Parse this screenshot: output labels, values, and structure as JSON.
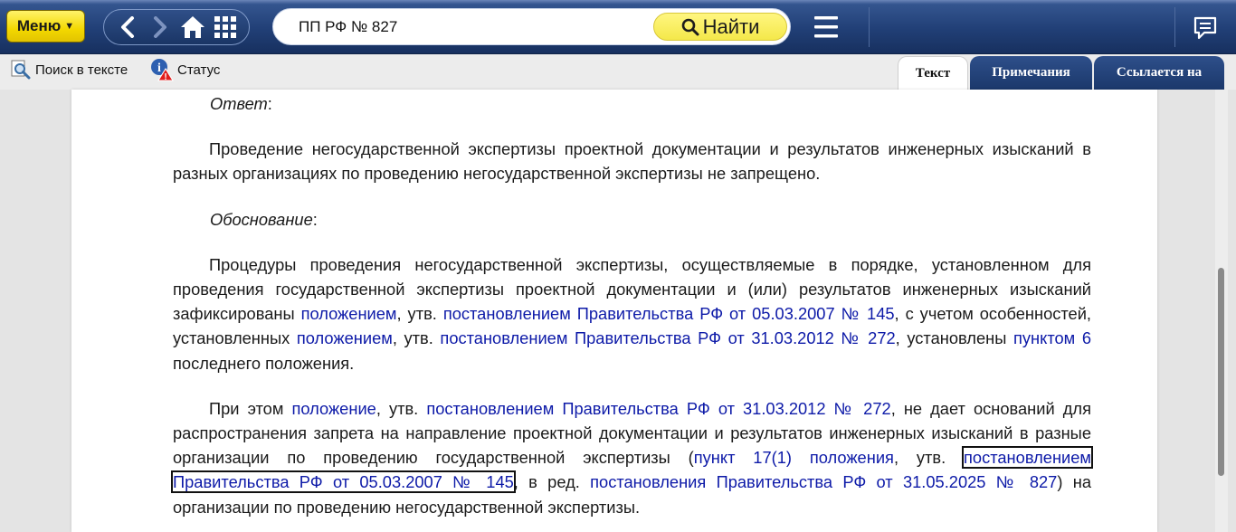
{
  "topbar": {
    "menu_label": "Меню",
    "search_value": "ПП РФ № 827",
    "find_label": "Найти"
  },
  "toolbar": {
    "search_in_text": "Поиск в тексте",
    "status": "Статус"
  },
  "tabs": [
    {
      "label": "Текст",
      "active": true
    },
    {
      "label": "Примечания",
      "active": false
    },
    {
      "label": "Ссылается на",
      "active": false
    }
  ],
  "doc": {
    "answer_label": "Ответ",
    "colon": ":",
    "p1": "Проведение негосударственной экспертизы проектной документации и результатов инженерных изысканий в разных организациях по проведению негосударственной экспертизы не запрещено.",
    "basis_label": "Обоснование",
    "p2": {
      "t1": "Процедуры проведения негосударственной экспертизы, осуществляемые в порядке, установленном для проведения государственной экспертизы проектной документации и (или) результатов инженерных изысканий зафиксированы ",
      "l1": "положением",
      "t2": ", утв. ",
      "l2": "постановлением Правительства РФ от 05.03.2007 № 145",
      "t3": ", с учетом особенностей, установленных ",
      "l3": "положением",
      "t4": ", утв. ",
      "l4": "постановлением Правительства РФ от 31.03.2012 № 272",
      "t5": ", установлены ",
      "l5": "пунктом 6",
      "t6": " последнего положения."
    },
    "p3": {
      "t1": "При этом ",
      "l1": "положение",
      "t2": ", утв. ",
      "l2": "постановлением Правительства РФ от 31.03.2012 № 272",
      "t3": ", не дает оснований для распространения запрета на направление проектной документации и результатов инженерных изысканий в разные организации по проведению государственной экспертизы (",
      "l3": "пункт 17(1) положения",
      "t4": ", утв. ",
      "l4": "постановлением Правительства РФ от 05.03.2007 № 145",
      "t5": ", в ред. ",
      "l5": "постановления Правительства РФ от 31.05.2025 № 827",
      "t6": ") на организации по проведению негосударственной экспертизы."
    }
  },
  "colors": {
    "link": "#0d1aa8",
    "topbar": "#213f76",
    "menu_button": "#f3d800",
    "find_button": "#f4e84a"
  },
  "icons": [
    "chevron-left-icon",
    "chevron-right-icon",
    "home-icon",
    "grid-icon",
    "magnifier-icon",
    "hamburger-icon",
    "chat-icon",
    "info-warning-icon"
  ]
}
